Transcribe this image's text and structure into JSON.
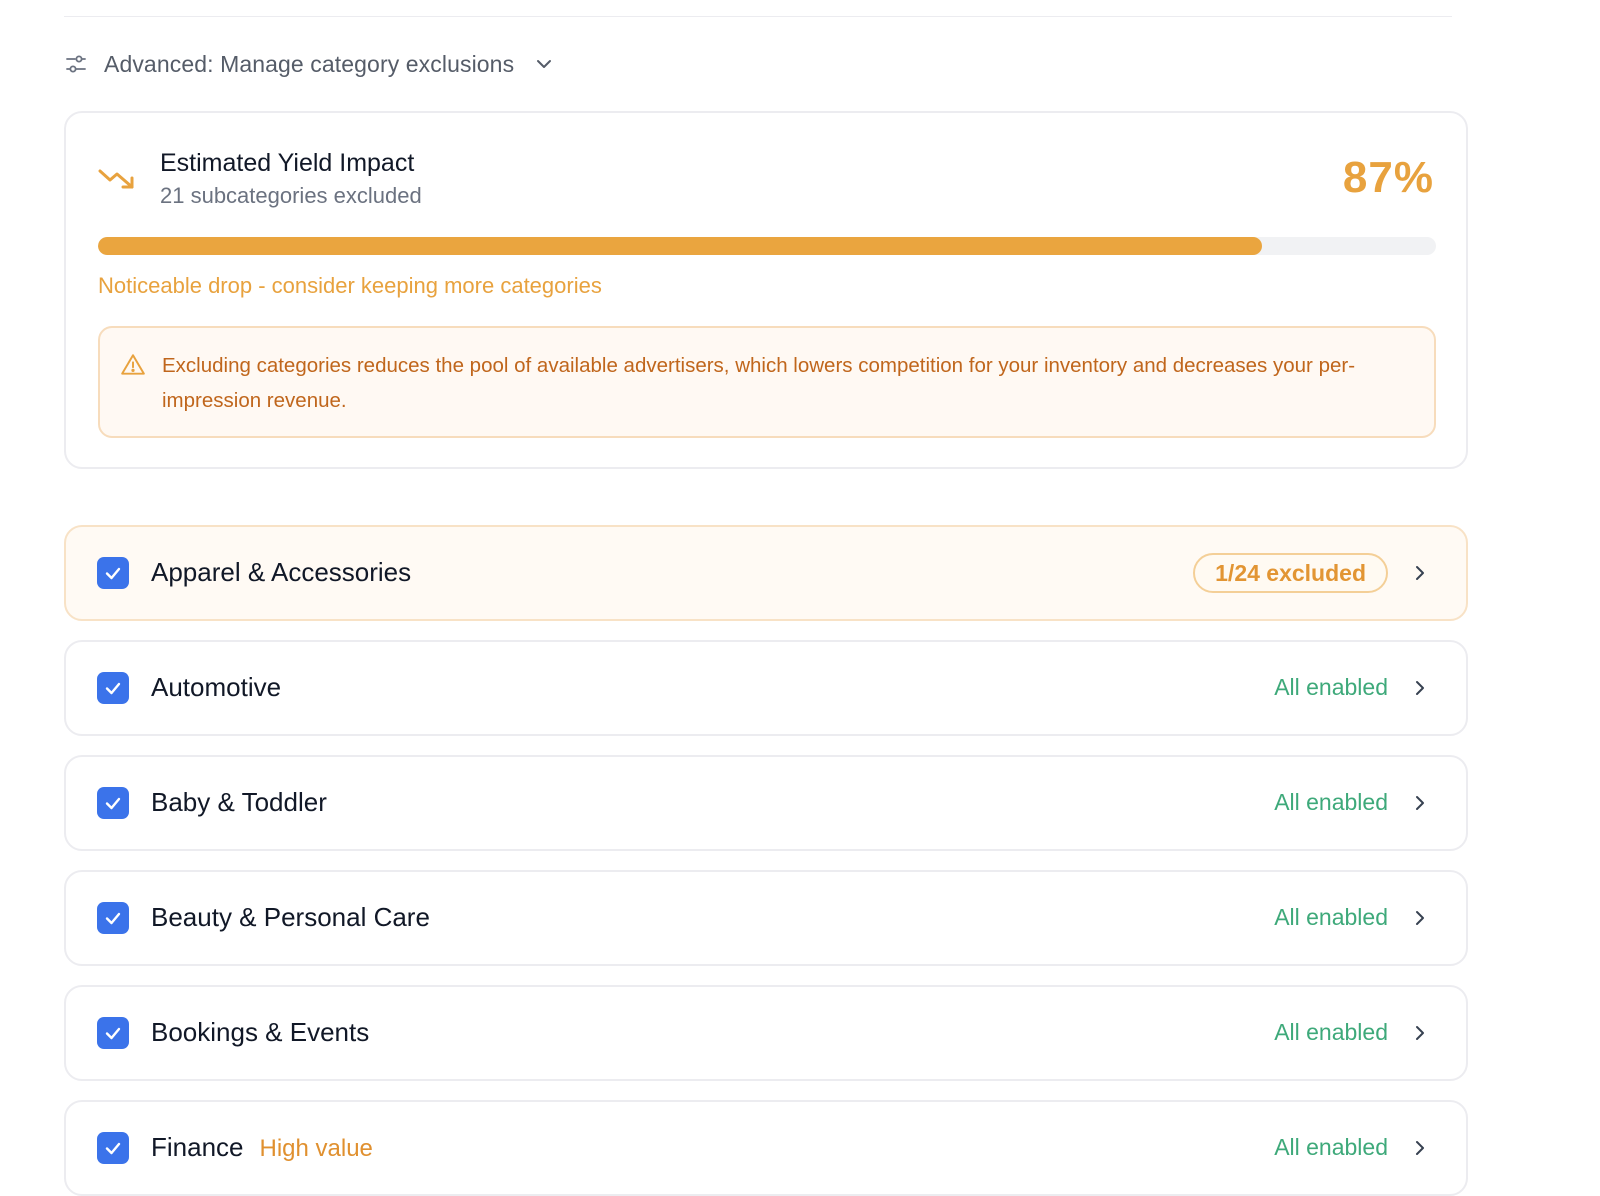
{
  "advanced": {
    "label": "Advanced: Manage category exclusions",
    "icon": "sliders-icon",
    "expand_icon": "chevron-down-icon"
  },
  "impact": {
    "title": "Estimated Yield Impact",
    "subtitle": "21 subcategories excluded",
    "percent_label": "87%",
    "progress_fraction": 0.87,
    "message": "Noticeable drop - consider keeping more categories",
    "warning": "Excluding categories reduces the pool of available advertisers, which lowers competition for your inventory and decreases your per-impression revenue.",
    "trend_icon": "trending-down-icon",
    "warning_icon": "warning-triangle-icon"
  },
  "colors": {
    "accent_orange": "#e8a23e",
    "checkbox_blue": "#3b73ea",
    "enabled_green": "#3ea97a",
    "warning_text": "#c0661c"
  },
  "categories": [
    {
      "name": "Apparel & Accessories",
      "badge": "",
      "status": "1/24 excluded",
      "partial": true,
      "checked": true
    },
    {
      "name": "Automotive",
      "badge": "",
      "status": "All enabled",
      "partial": false,
      "checked": true
    },
    {
      "name": "Baby & Toddler",
      "badge": "",
      "status": "All enabled",
      "partial": false,
      "checked": true
    },
    {
      "name": "Beauty & Personal Care",
      "badge": "",
      "status": "All enabled",
      "partial": false,
      "checked": true
    },
    {
      "name": "Bookings & Events",
      "badge": "",
      "status": "All enabled",
      "partial": false,
      "checked": true
    },
    {
      "name": "Finance",
      "badge": "High value",
      "status": "All enabled",
      "partial": false,
      "checked": true
    }
  ]
}
